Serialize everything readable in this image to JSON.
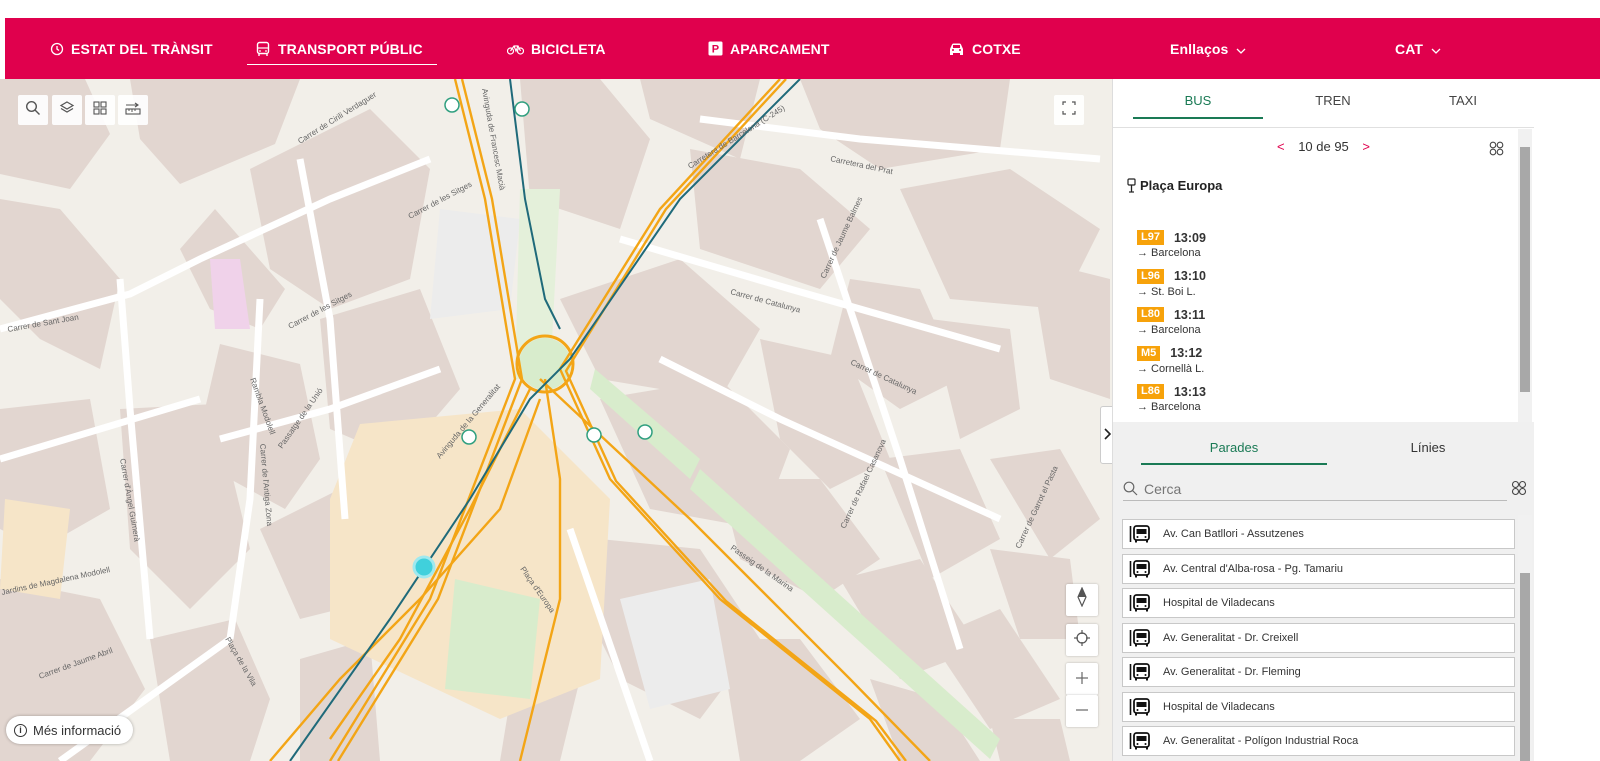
{
  "nav": {
    "items": [
      {
        "label": "ESTAT DEL TRÀNSIT",
        "icon": "clock-icon"
      },
      {
        "label": "TRANSPORT PÚBLIC",
        "icon": "bus-icon"
      },
      {
        "label": "BICICLETA",
        "icon": "bicycle-icon"
      },
      {
        "label": "APARCAMENT",
        "icon": "parking-icon"
      },
      {
        "label": "COTXE",
        "icon": "car-icon"
      }
    ],
    "links_label": "Enllaços",
    "lang_label": "CAT",
    "active": "TRANSPORT PÚBLIC",
    "accent": "#e0004d"
  },
  "map": {
    "more_info_label": "Més informació",
    "street_labels": [
      "Carrer de Cirili Verdaguer",
      "Carrer de les Sitges",
      "Carrer de Sant Joan",
      "Rambla Modolell",
      "Passatge de la Unió",
      "Avinguda de la Generalitat",
      "Carretera de Barcelona (C-245)",
      "Carretera del Prat",
      "Carrer de Catalunya",
      "Carrer de Jaume Balmes",
      "Carrer de Rafael Casanova",
      "Carrer de Garrot el Pasta",
      "Passeig de la Marina",
      "Plaça d'Europa",
      "Jardins de Magdalena Modolell",
      "Carrer d'Àngel Guimerà",
      "Plaça de la Vila",
      "Carrer de Jaume Abril",
      "Avinguda de Francesc Macià",
      "Carrer de l'Antiga Zona"
    ],
    "colors": {
      "bg": "#f2efe9",
      "block": "#e2d6d0",
      "line_orange": "#f3a516",
      "line_teal": "#1f6a7a"
    }
  },
  "panel": {
    "tabs": [
      "BUS",
      "TREN",
      "TAXI"
    ],
    "active_tab": "BUS",
    "pager": {
      "prev": "<",
      "text": "10 de 95",
      "next": ">"
    },
    "stop_name": "Plaça Europa",
    "arrivals": [
      {
        "line": "L97",
        "time": "13:09",
        "dest": "→ Barcelona"
      },
      {
        "line": "L96",
        "time": "13:10",
        "dest": "→ St. Boi L."
      },
      {
        "line": "L80",
        "time": "13:11",
        "dest": "→ Barcelona"
      },
      {
        "line": "M5",
        "time": "13:12",
        "dest": "→ Cornellà L."
      },
      {
        "line": "L86",
        "time": "13:13",
        "dest": "→ Barcelona"
      }
    ],
    "subtabs": [
      "Parades",
      "Línies"
    ],
    "active_subtab": "Parades",
    "search_placeholder": "Cerca",
    "stops": [
      "Av. Can Batllori - Assutzenes",
      "Av. Central d'Alba-rosa - Pg. Tamariu",
      "Hospital de Viladecans",
      "Av. Generalitat - Dr. Creixell",
      "Av. Generalitat - Dr. Fleming",
      "Hospital de Viladecans",
      "Av. Generalitat - Polígon Industrial Roca"
    ]
  }
}
